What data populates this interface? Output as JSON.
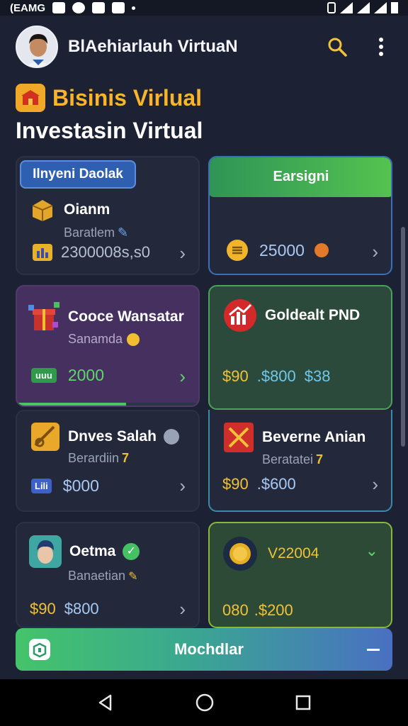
{
  "status": {
    "time": "(EAMG"
  },
  "header": {
    "title": "BlAehiarlauh VirtuaN"
  },
  "heading": {
    "brand": "Bisinis Virlual",
    "subtitle": "Investasin Virtual"
  },
  "tiles": {
    "t1": {
      "tab": "Ilnyeni Daolak",
      "name": "Oianm",
      "sub": "Baratlem",
      "amount": "2300008s,s0"
    },
    "t2": {
      "tab": "Earsigni",
      "amount": "25000"
    },
    "t3": {
      "name": "Cooce Wansatar",
      "sub": "Sanamda",
      "amount": "2000",
      "badge": "uuu"
    },
    "t4": {
      "name": "Goldealt PND",
      "amount1": "$90",
      "amount2": ".$800",
      "amount3": "$38"
    },
    "t5": {
      "name": "Dnves Salah",
      "sub": "Berardiin",
      "subnum": "7",
      "amount": "$000",
      "badge": "Lili"
    },
    "t6": {
      "name": "Beverne Anian",
      "sub": "Beratatei",
      "subnum": "7",
      "amount1": "$90",
      "amount2": ".$600"
    },
    "t7": {
      "name": "Oetma",
      "sub": "Banaetian",
      "amount1": "$90",
      "amount2": "$800"
    },
    "t8": {
      "name": "V22004",
      "amount1": "080",
      "amount2": ".$200"
    }
  },
  "bottom_action": {
    "label": "Mochdlar"
  },
  "colors": {
    "gold": "#f7b52b",
    "green": "#45c063",
    "purple": "#4a3364",
    "blue": "#3a6fd8"
  }
}
